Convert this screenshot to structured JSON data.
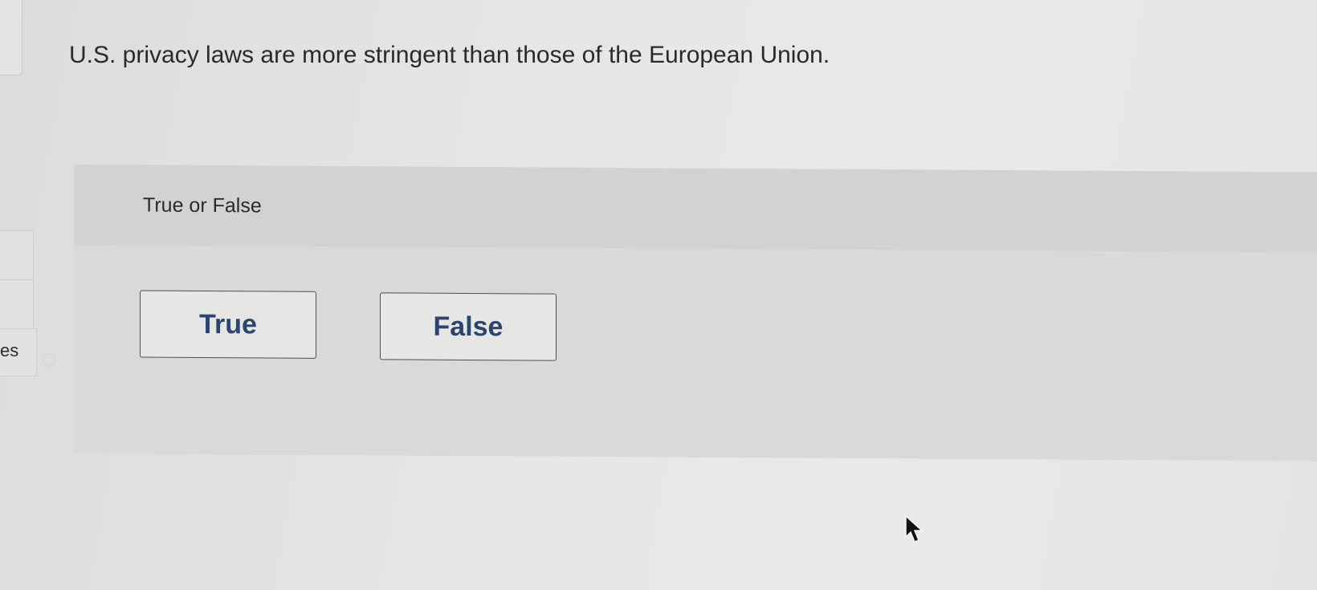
{
  "question": {
    "text": "U.S. privacy laws are more stringent than those of the European Union."
  },
  "answer": {
    "prompt": "True or False",
    "options": [
      {
        "label": "True"
      },
      {
        "label": "False"
      }
    ]
  },
  "sidebar": {
    "partial_label": "es"
  },
  "colors": {
    "button_text": "#2e4470",
    "button_border": "#4d4f55",
    "panel_bg": "#d9d9d7"
  }
}
